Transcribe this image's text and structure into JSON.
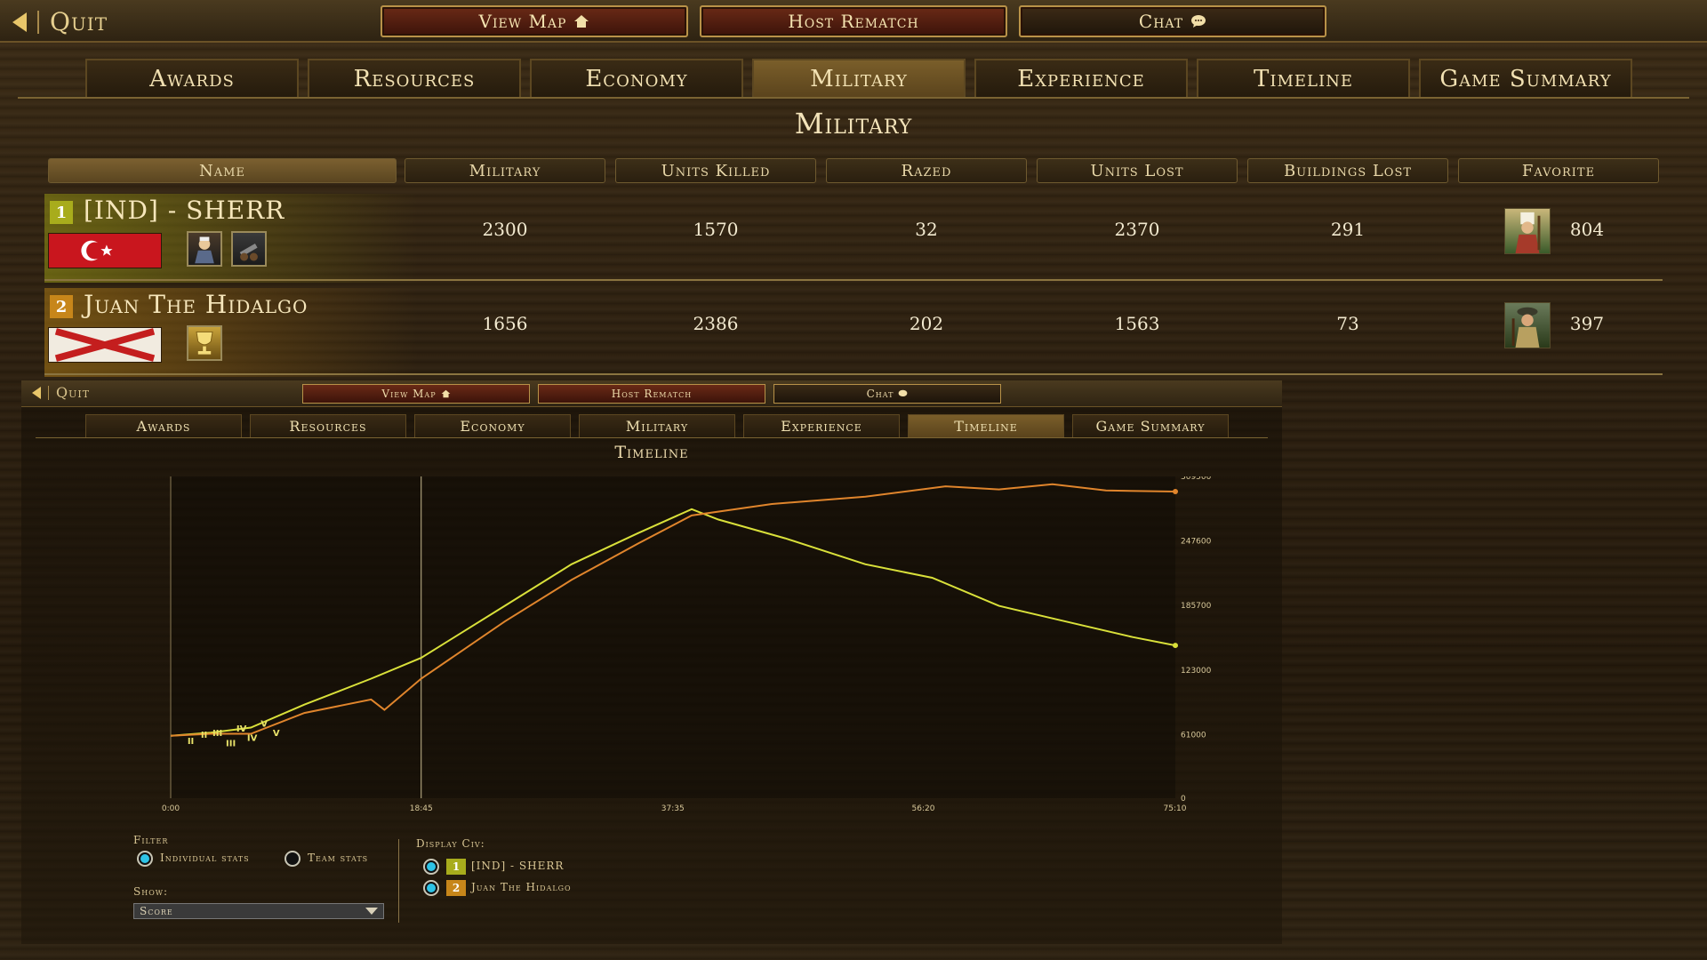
{
  "topbar": {
    "quit": "Quit",
    "view_map": "View Map",
    "host_rematch": "Host Rematch",
    "chat": "Chat"
  },
  "tabs": [
    "Awards",
    "Resources",
    "Economy",
    "Military",
    "Experience",
    "Timeline",
    "Game Summary"
  ],
  "active_tab": "Military",
  "section_title": "Military",
  "table": {
    "headers": [
      "Name",
      "Military",
      "Units Killed",
      "Razed",
      "Units Lost",
      "Buildings Lost",
      "Favorite"
    ],
    "rows": [
      {
        "rank": "1",
        "name": "[IND] - SHERR",
        "color": "#a8ac1c",
        "military": "2300",
        "units_killed": "1570",
        "razed": "32",
        "units_lost": "2370",
        "buildings_lost": "291",
        "favorite_count": "804",
        "flag": "ottoman-flag",
        "favorite_icon": "janissary-icon"
      },
      {
        "rank": "2",
        "name": "Juan The Hidalgo",
        "color": "#c7861a",
        "military": "1656",
        "units_killed": "2386",
        "razed": "202",
        "units_lost": "1563",
        "buildings_lost": "73",
        "favorite_count": "397",
        "flag": "spanish-burgundy-flag",
        "favorite_icon": "musketeer-icon"
      }
    ]
  },
  "embedded": {
    "quit": "Quit",
    "view_map": "View Map",
    "host_rematch": "Host Rematch",
    "chat": "Chat",
    "tabs": [
      "Awards",
      "Resources",
      "Economy",
      "Military",
      "Experience",
      "Timeline",
      "Game Summary"
    ],
    "active_tab": "Timeline",
    "title": "Timeline",
    "filter": {
      "label": "Filter",
      "individual": "Individual stats",
      "team": "Team stats",
      "selected": "individual"
    },
    "show": {
      "label": "Show:",
      "value": "Score"
    },
    "display_civ": {
      "label": "Display Civ:",
      "civs": [
        {
          "rank": "1",
          "name": "[IND] - SHERR",
          "color": "#a8ac1c"
        },
        {
          "rank": "2",
          "name": "Juan The Hidalgo",
          "color": "#c7861a"
        }
      ]
    }
  },
  "chart_data": {
    "type": "line",
    "title": "Timeline",
    "x_ticks": [
      "0:00",
      "18:45",
      "37:35",
      "56:20",
      "75:10"
    ],
    "y_ticks": [
      "0",
      "61000",
      "123000",
      "185700",
      "247600",
      "309500"
    ],
    "ylim": [
      0,
      309500
    ],
    "marker_line_x": "18:45",
    "age_markers": [
      "II",
      "III",
      "IV",
      "V"
    ],
    "series": [
      {
        "name": "[IND] - SHERR",
        "color": "#d9e03a",
        "points": [
          [
            0,
            60000
          ],
          [
            3,
            63000
          ],
          [
            6,
            68000
          ],
          [
            10,
            90000
          ],
          [
            15,
            115000
          ],
          [
            18.75,
            135000
          ],
          [
            25,
            185000
          ],
          [
            30,
            225000
          ],
          [
            35,
            255000
          ],
          [
            39,
            278000
          ],
          [
            41,
            268000
          ],
          [
            46,
            250000
          ],
          [
            52,
            225000
          ],
          [
            57,
            212000
          ],
          [
            62,
            185000
          ],
          [
            67,
            170000
          ],
          [
            72,
            155000
          ],
          [
            75.2,
            147000
          ]
        ]
      },
      {
        "name": "Juan The Hidalgo",
        "color": "#e0852c",
        "points": [
          [
            0,
            60000
          ],
          [
            3,
            62000
          ],
          [
            6,
            62000
          ],
          [
            10,
            82000
          ],
          [
            15,
            95000
          ],
          [
            16,
            85000
          ],
          [
            18.75,
            115000
          ],
          [
            25,
            170000
          ],
          [
            30,
            210000
          ],
          [
            35,
            245000
          ],
          [
            39,
            272000
          ],
          [
            45,
            283000
          ],
          [
            52,
            290000
          ],
          [
            58,
            300000
          ],
          [
            62,
            297000
          ],
          [
            66,
            302000
          ],
          [
            70,
            296000
          ],
          [
            75.2,
            295000
          ]
        ]
      }
    ]
  }
}
